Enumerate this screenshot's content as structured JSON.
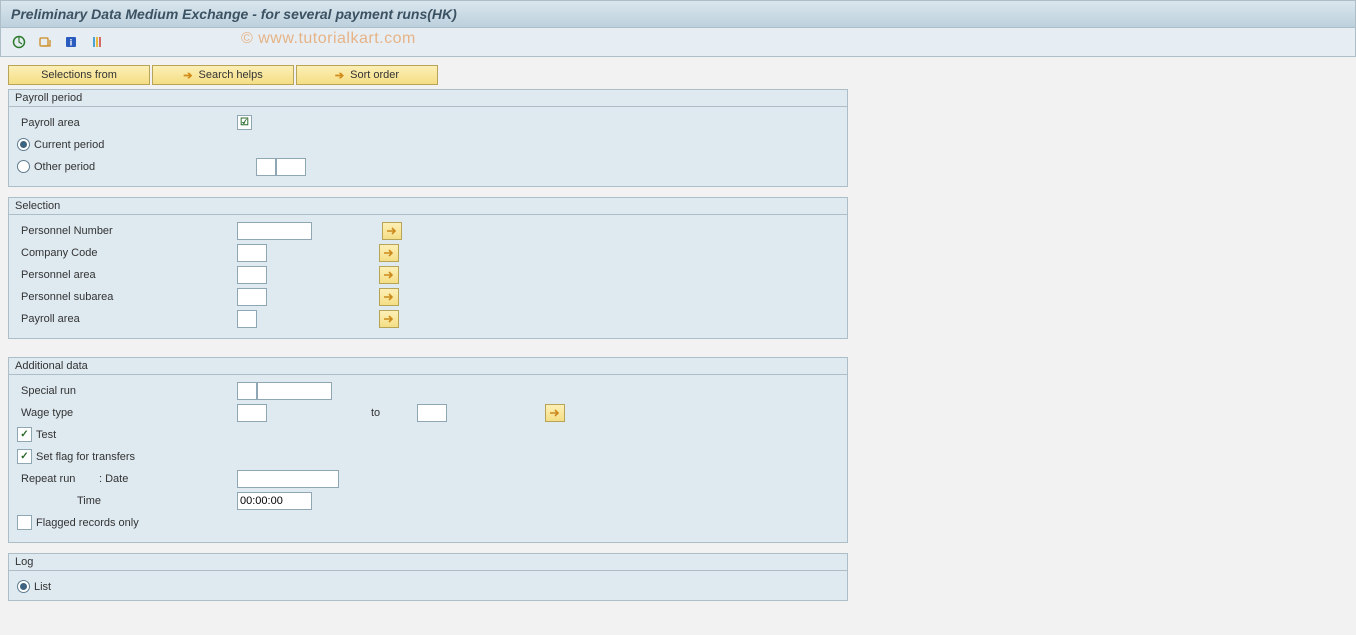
{
  "window_title": "Preliminary Data Medium Exchange - for several payment runs(HK)",
  "watermark": "© www.tutorialkart.com",
  "toolbar_buttons": {
    "selections_from": "Selections from",
    "search_helps": "Search helps",
    "sort_order": "Sort order"
  },
  "groups": {
    "payroll_period": {
      "title": "Payroll period",
      "payroll_area_label": "Payroll area",
      "current_period_label": "Current period",
      "other_period_label": "Other period",
      "period_radio": "current",
      "payroll_area_value": "",
      "other_period_val1": "",
      "other_period_val2": ""
    },
    "selection": {
      "title": "Selection",
      "rows": [
        {
          "label": "Personnel Number",
          "value": "",
          "width": "w70"
        },
        {
          "label": "Company Code",
          "value": "",
          "width": "w30"
        },
        {
          "label": "Personnel area",
          "value": "",
          "width": "w30"
        },
        {
          "label": "Personnel subarea",
          "value": "",
          "width": "w30"
        },
        {
          "label": "Payroll area",
          "value": "",
          "width": "w20"
        }
      ]
    },
    "additional": {
      "title": "Additional data",
      "special_run_label": "Special run",
      "special_run_v1": "",
      "special_run_v2": "",
      "wage_type_label": "Wage type",
      "wage_type_from": "",
      "to_label": "to",
      "wage_type_to": "",
      "test_label": "Test",
      "test_checked": true,
      "set_flag_label": "Set flag for transfers",
      "set_flag_checked": true,
      "repeat_run_label": "Repeat run",
      "date_label": ": Date",
      "date_value": "",
      "time_label": "Time",
      "time_value": "00:00:00",
      "flagged_only_label": "Flagged records only",
      "flagged_only_checked": false
    },
    "log": {
      "title": "Log",
      "list_label": "List",
      "list_selected": true
    }
  }
}
